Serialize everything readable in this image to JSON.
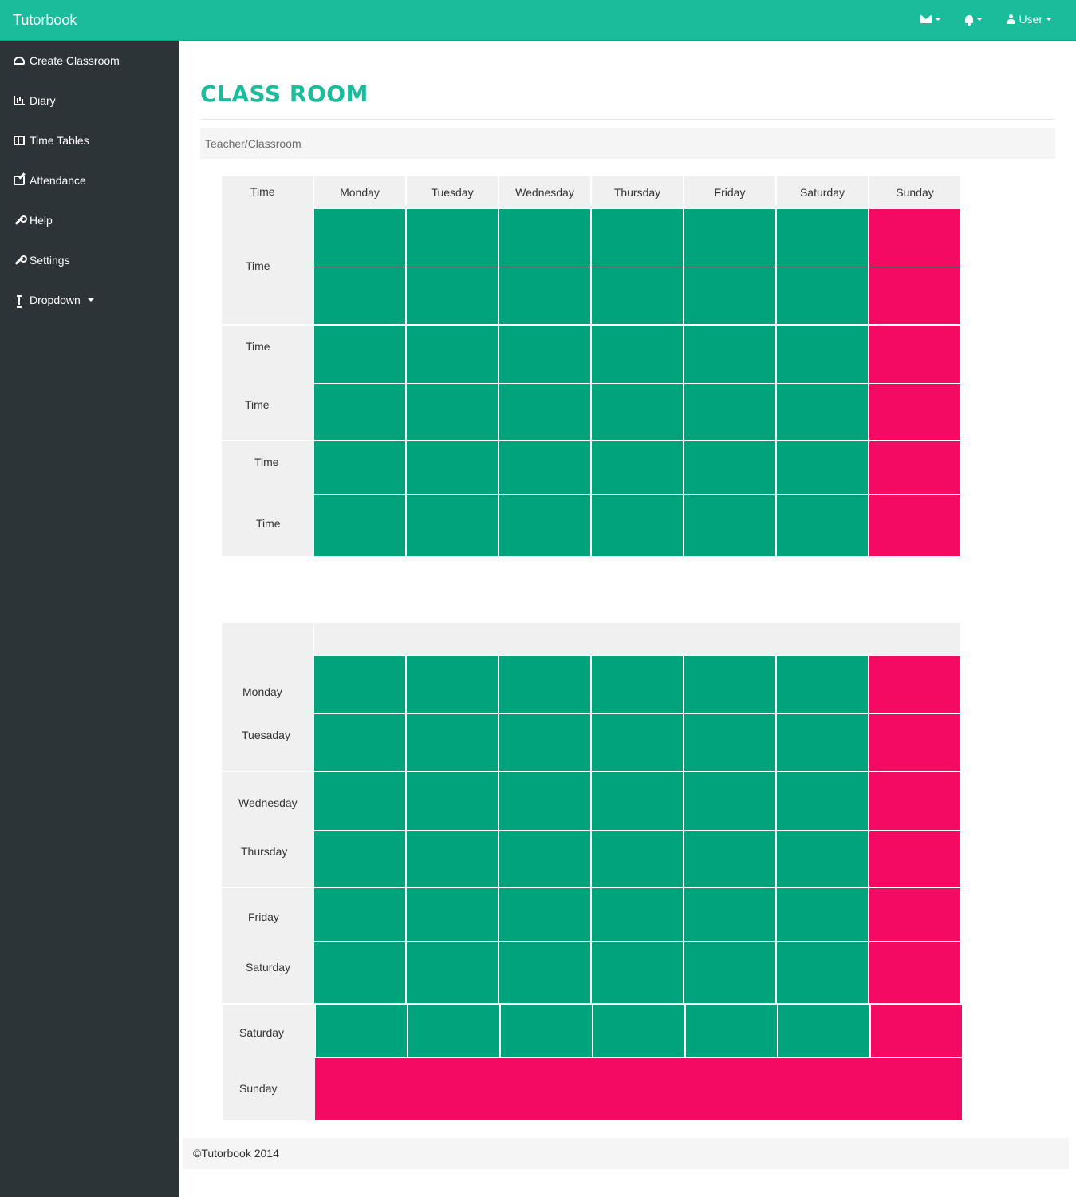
{
  "app": {
    "brand": "Tutorbook"
  },
  "topnav": {
    "user_label": "User"
  },
  "sidebar": {
    "items": [
      {
        "label": "Create Classroom",
        "icon": "dashboard-icon"
      },
      {
        "label": "Diary",
        "icon": "bar-chart-icon"
      },
      {
        "label": "Time Tables",
        "icon": "table-icon"
      },
      {
        "label": "Attendance",
        "icon": "edit-icon"
      },
      {
        "label": "Help",
        "icon": "wrench-icon"
      },
      {
        "label": "Settings",
        "icon": "wrench-icon"
      },
      {
        "label": "Dropdown",
        "icon": "vertical-resize-icon"
      }
    ]
  },
  "page": {
    "title": "CLASS ROOM",
    "breadcrumb": "Teacher/Classroom"
  },
  "colors": {
    "brand": "#1abc9c",
    "sidebar": "#2c3438",
    "slot_green": "#00a37c",
    "slot_pink": "#f50a63"
  },
  "table1": {
    "corner": "Time",
    "days": [
      "Monday",
      "Tuesday",
      "Wednesday",
      "Thursday",
      "Friday",
      "Saturday",
      "Sunday"
    ],
    "row_labels": [
      "Time",
      "Time",
      "Time",
      "Time",
      "Time"
    ]
  },
  "table2": {
    "row_labels": [
      "Monday",
      "Tuesaday",
      "Wednesday",
      "Thursday",
      "Friday",
      "Saturday",
      "Saturday",
      "Sunday"
    ]
  },
  "footer": {
    "text": "©Tutorbook 2014"
  }
}
